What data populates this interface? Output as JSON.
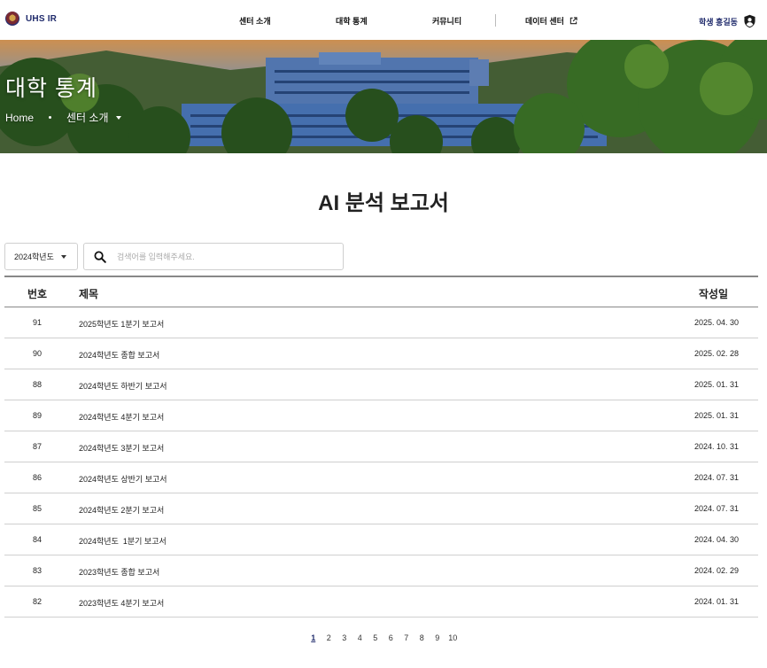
{
  "header": {
    "logo_text": "UHS IR",
    "nav": [
      {
        "label": "센터 소개"
      },
      {
        "label": "대학 통계"
      },
      {
        "label": "커뮤니티"
      },
      {
        "label": "데이터 센터"
      }
    ],
    "user_name": "학생 홍길동",
    "icons": {
      "logo": "university-emblem-icon",
      "external": "external-link-icon",
      "user": "user-shield-icon"
    }
  },
  "hero": {
    "title": "대학 통계",
    "breadcrumb": {
      "home": "Home",
      "current": "센터 소개"
    }
  },
  "main": {
    "title": "AI 분석 보고서",
    "year_select": {
      "value": "2024학년도"
    },
    "search": {
      "placeholder": "검색어를 입력해주세요.",
      "value": ""
    },
    "table": {
      "headers": {
        "num": "번호",
        "title": "제목",
        "date": "작성일"
      },
      "rows": [
        {
          "num": "91",
          "title": "2025학년도 1분기 보고서",
          "date": "2025. 04. 30"
        },
        {
          "num": "90",
          "title": "2024학년도 종합 보고서",
          "date": "2025. 02. 28"
        },
        {
          "num": "88",
          "title": "2024학년도 하반기 보고서",
          "date": "2025. 01. 31"
        },
        {
          "num": "89",
          "title": "2024학년도 4분기 보고서",
          "date": "2025. 01. 31"
        },
        {
          "num": "87",
          "title": "2024학년도 3분기 보고서",
          "date": "2024. 10. 31"
        },
        {
          "num": "86",
          "title": "2024학년도 상반기 보고서",
          "date": "2024. 07. 31"
        },
        {
          "num": "85",
          "title": "2024학년도 2분기 보고서",
          "date": "2024. 07. 31"
        },
        {
          "num": "84",
          "title": "2024학년도  1분기 보고서",
          "date": "2024. 04. 30"
        },
        {
          "num": "83",
          "title": "2023학년도 종합 보고서",
          "date": "2024. 02. 29"
        },
        {
          "num": "82",
          "title": "2023학년도 4분기 보고서",
          "date": "2024. 01. 31"
        }
      ]
    },
    "pagination": {
      "pages": [
        "1",
        "2",
        "3",
        "4",
        "5",
        "6",
        "7",
        "8",
        "9",
        "10"
      ],
      "current": "1"
    }
  },
  "colors": {
    "brand": "#1f2a6b",
    "text": "#222222",
    "border": "#cfcfcf"
  }
}
